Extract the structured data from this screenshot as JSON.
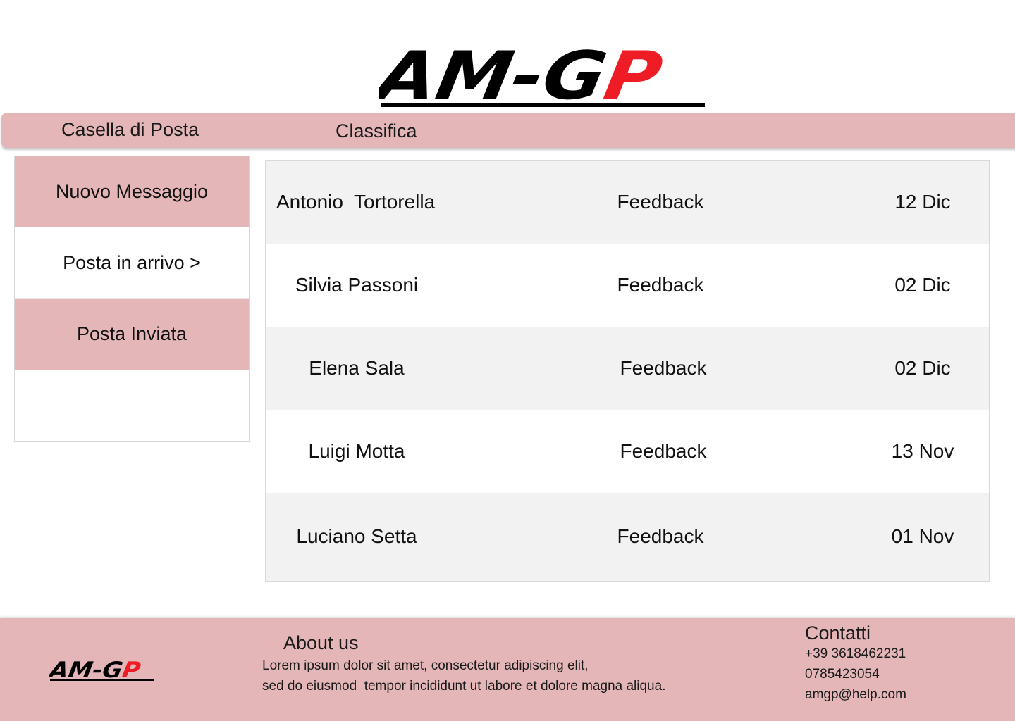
{
  "brand": {
    "logo_text_black": "AM-G",
    "logo_text_red": "P",
    "logo_color_black": "#000000",
    "logo_color_red": "#ee1c25"
  },
  "colors": {
    "accent_pink": "#e4b6b8",
    "row_alt": "#f2f2f2"
  },
  "topnav": {
    "casella": "Casella di Posta",
    "classifica": "Classifica"
  },
  "sidebar": {
    "items": [
      {
        "label": "Nuovo Messaggio"
      },
      {
        "label": "Posta in arrivo >"
      },
      {
        "label": "Posta Inviata"
      }
    ]
  },
  "messages": [
    {
      "sender": "Antonio  Tortorella",
      "subject": "Feedback",
      "date": "12 Dic"
    },
    {
      "sender": "Silvia Passoni",
      "subject": "Feedback",
      "date": "02 Dic"
    },
    {
      "sender": "Elena Sala",
      "subject": "Feedback",
      "date": "02 Dic"
    },
    {
      "sender": "Luigi Motta",
      "subject": "Feedback",
      "date": "13 Nov"
    },
    {
      "sender": "Luciano Setta",
      "subject": "Feedback",
      "date": "01 Nov"
    }
  ],
  "footer": {
    "about_title": "About us",
    "about_text": "Lorem ipsum dolor sit amet, consectetur adipiscing elit,\nsed do eiusmod  tempor incididunt ut labore et dolore magna aliqua.",
    "contact_title": "Contatti",
    "phone1": "+39 3618462231",
    "phone2": "0785423054",
    "email": "amgp@help.com"
  }
}
